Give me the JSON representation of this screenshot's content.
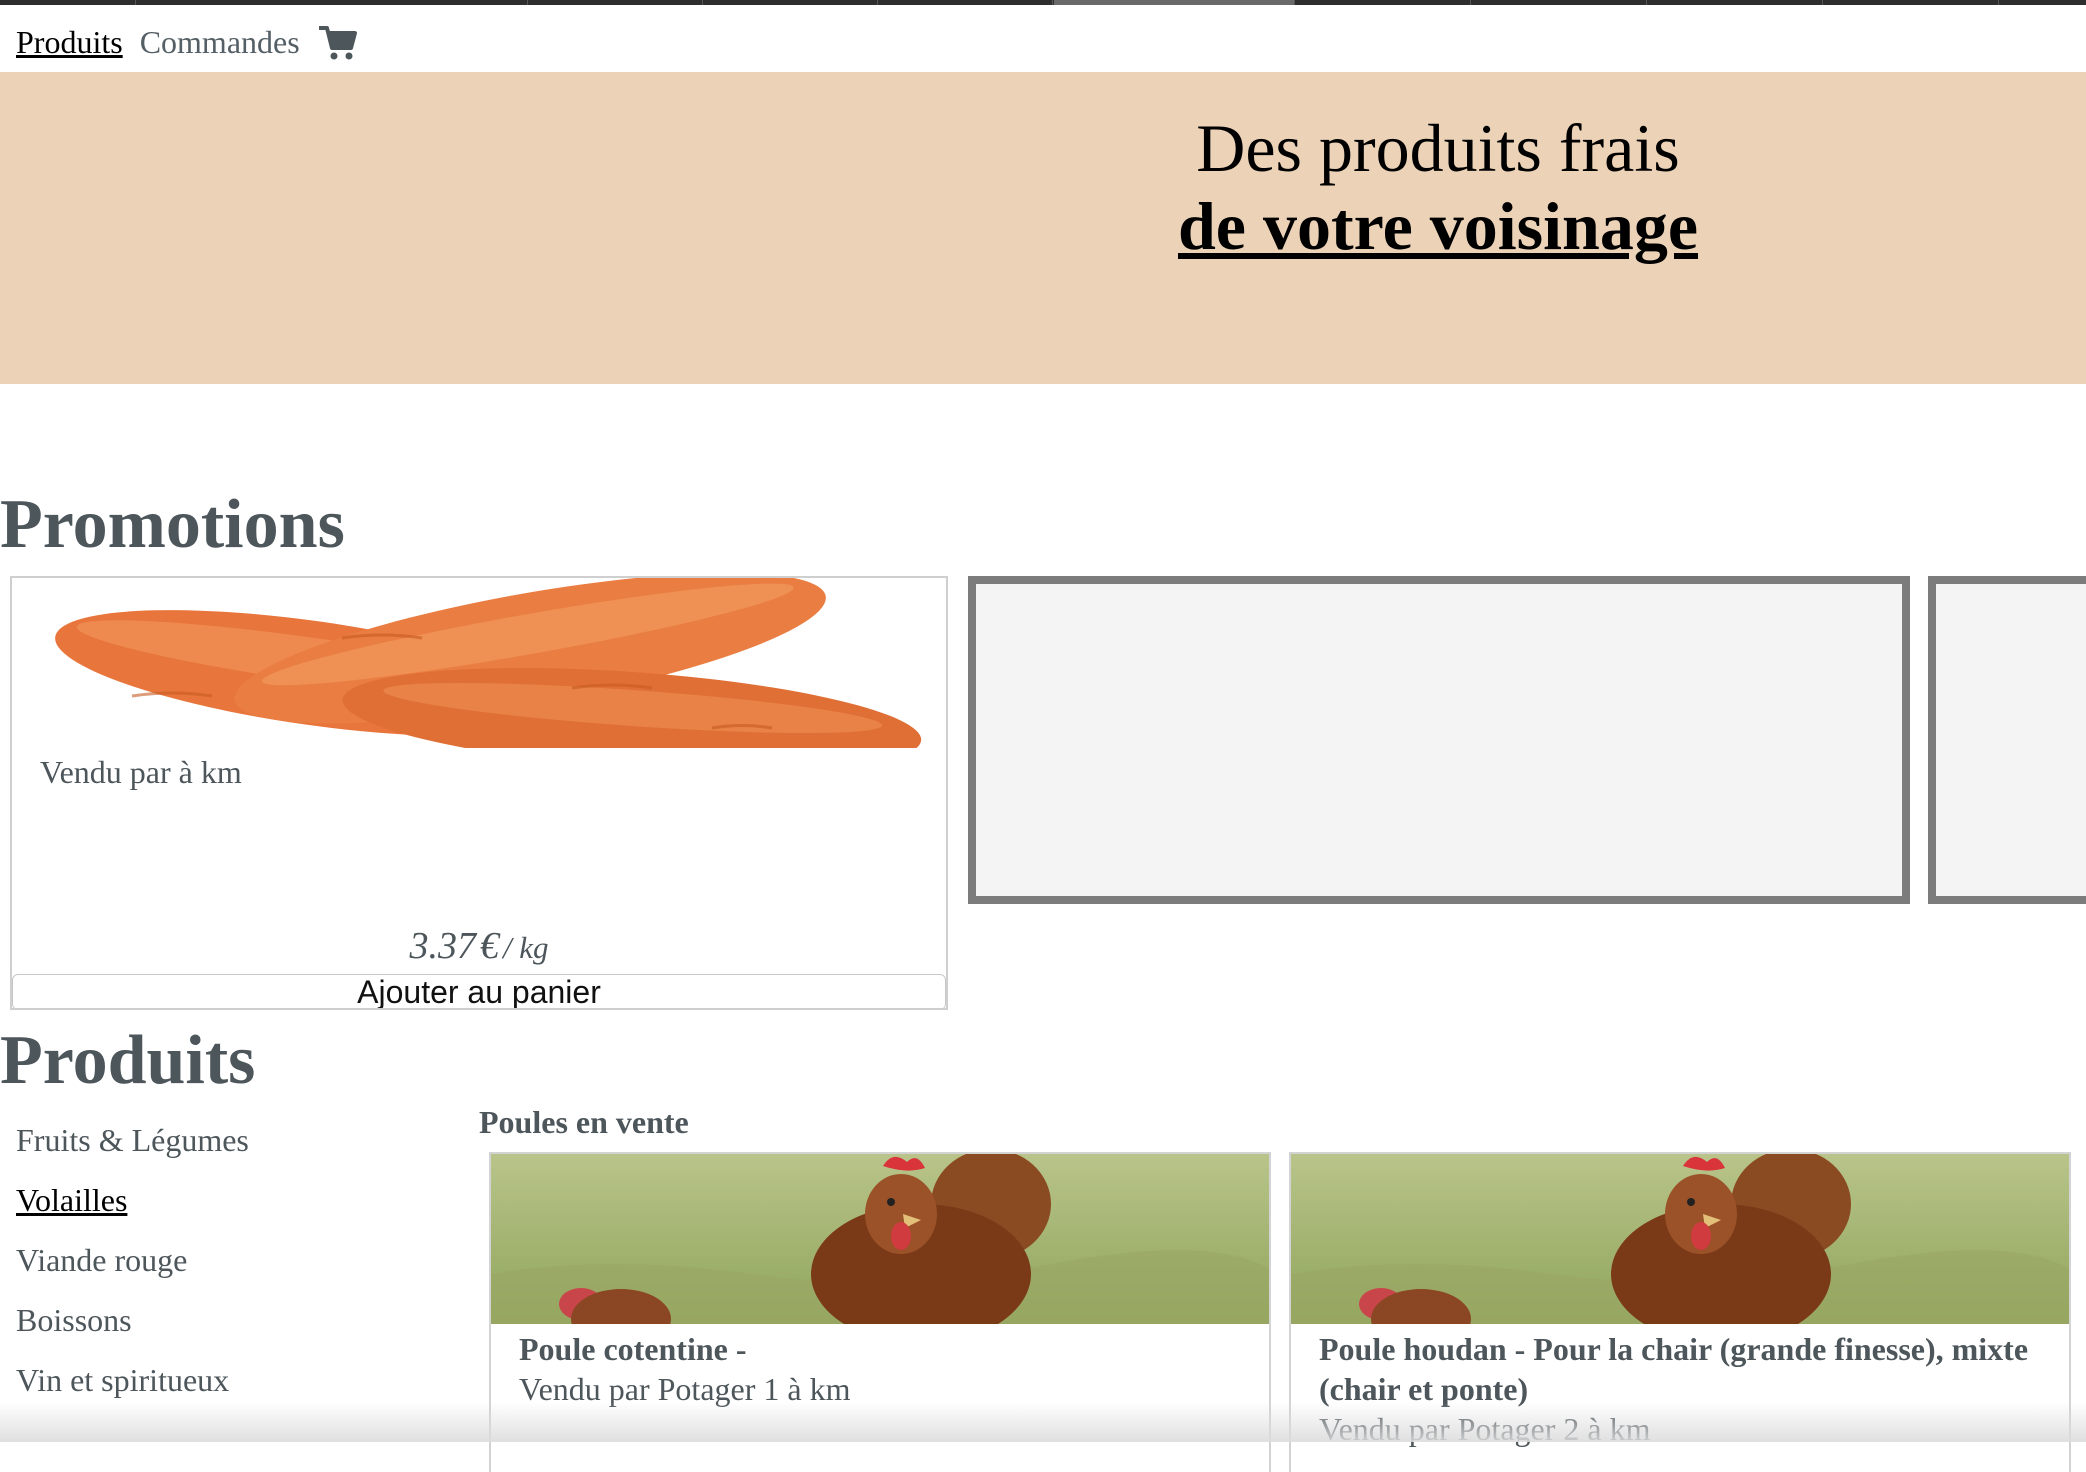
{
  "nav": {
    "products_label": "Produits",
    "orders_label": "Commandes",
    "cart_icon": "shopping-cart-icon"
  },
  "hero": {
    "line1": "Des produits frais",
    "line2": "de votre voisinage",
    "background": "#ecd3b8"
  },
  "promotions": {
    "heading": "Promotions",
    "card": {
      "image": "carrots-photo",
      "seller": "Vendu par à km",
      "price_amount": "3.37",
      "price_currency": "€",
      "price_unit": "/ kg",
      "button_label": "Ajouter au panier"
    }
  },
  "products": {
    "heading": "Produits",
    "categories": [
      {
        "label": "Fruits & Légumes",
        "current": false
      },
      {
        "label": "Volailles",
        "current": true
      },
      {
        "label": "Viande rouge",
        "current": false
      },
      {
        "label": "Boissons",
        "current": false
      },
      {
        "label": "Vin et spiritueux",
        "current": false
      }
    ],
    "section_title": "Poules en vente",
    "items": [
      {
        "image": "hens-photo",
        "name": "Poule cotentine -",
        "seller": "Vendu par Potager 1 à km"
      },
      {
        "image": "hens-photo",
        "name": "Poule houdan - Pour la chair (grande finesse), mixte (chair et ponte)",
        "seller": "Vendu par Potager 2 à km"
      }
    ]
  },
  "colors": {
    "text_muted": "#4d565b",
    "placeholder_border": "#7c7c7c",
    "placeholder_fill": "#f4f4f4"
  }
}
